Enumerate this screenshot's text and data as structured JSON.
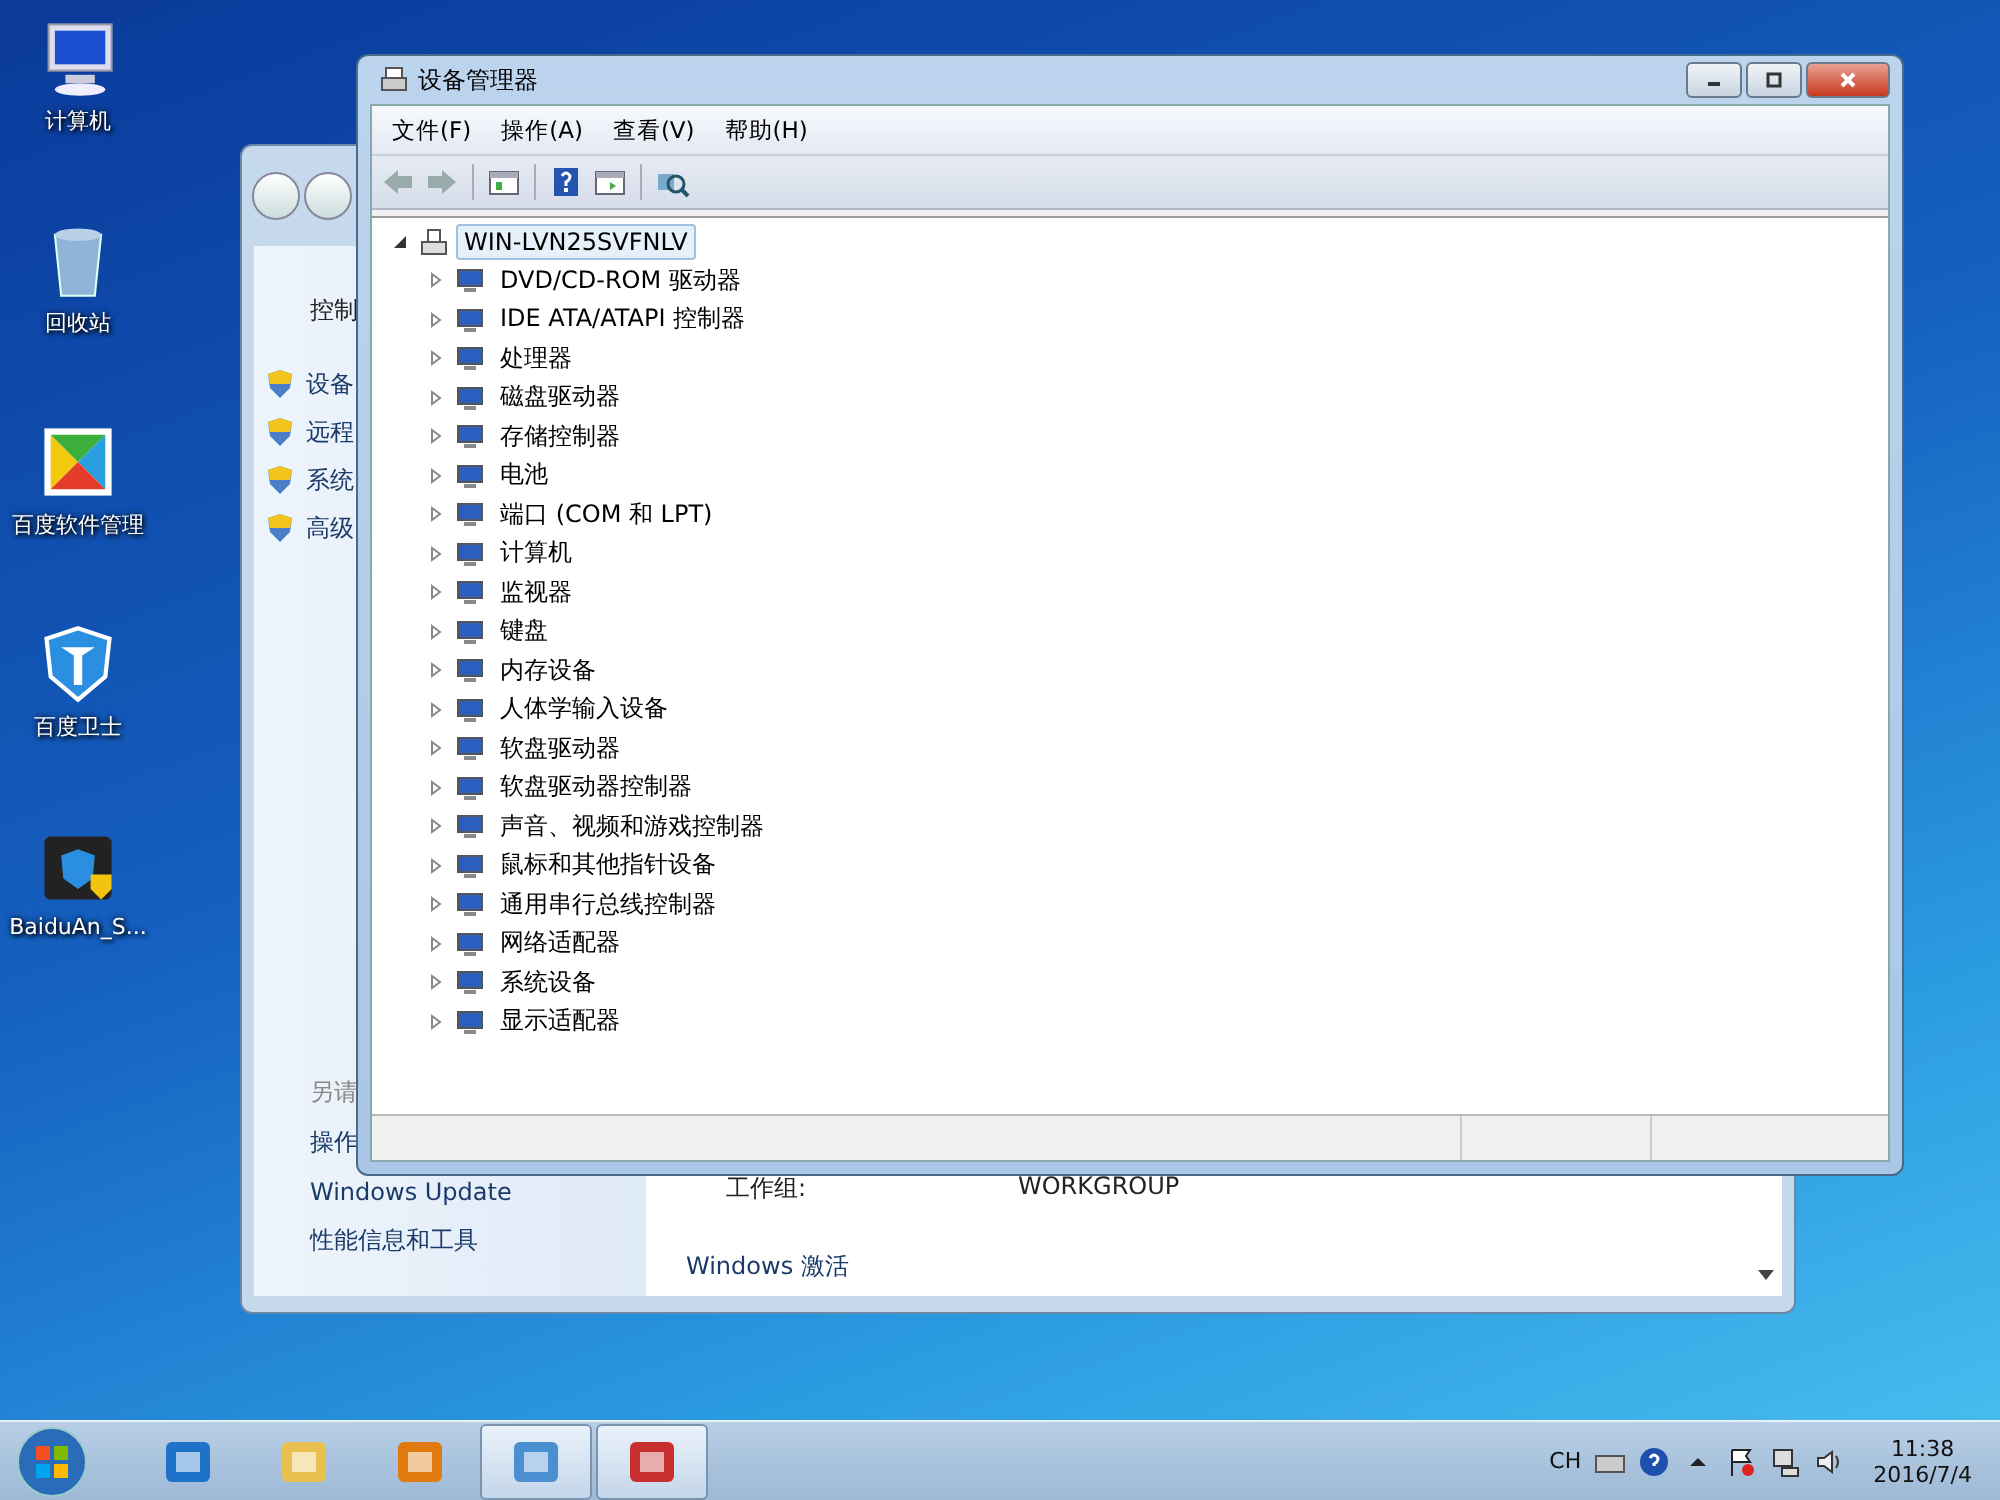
{
  "desktop_icons": [
    {
      "label": "计算机"
    },
    {
      "label": "回收站"
    },
    {
      "label": "百度软件管理"
    },
    {
      "label": "百度卫士"
    },
    {
      "label": "BaiduAn_S..."
    }
  ],
  "background_window": {
    "left_pane": {
      "title": "控制",
      "links": [
        "设备",
        "远程",
        "系统",
        "高级"
      ],
      "see_also": "另请",
      "see_also_links": [
        "操作",
        "Windows Update",
        "性能信息和工具"
      ]
    },
    "details": [
      {
        "label": "工作组:",
        "value": "WORKGROUP"
      }
    ],
    "section": "Windows 激活"
  },
  "window": {
    "title": "设备管理器",
    "menu": [
      "文件(F)",
      "操作(A)",
      "查看(V)",
      "帮助(H)"
    ],
    "tree": {
      "label": "WIN-LVN25SVFNLV",
      "expanded": true,
      "selected": true,
      "children": [
        {
          "label": "DVD/CD-ROM 驱动器",
          "expanded": false
        },
        {
          "label": "IDE ATA/ATAPI 控制器",
          "expanded": false
        },
        {
          "label": "处理器",
          "expanded": false
        },
        {
          "label": "磁盘驱动器",
          "expanded": false
        },
        {
          "label": "存储控制器",
          "expanded": false
        },
        {
          "label": "电池",
          "expanded": false
        },
        {
          "label": "端口 (COM 和 LPT)",
          "expanded": false
        },
        {
          "label": "计算机",
          "expanded": false
        },
        {
          "label": "监视器",
          "expanded": false
        },
        {
          "label": "键盘",
          "expanded": false
        },
        {
          "label": "内存设备",
          "expanded": false
        },
        {
          "label": "人体学输入设备",
          "expanded": false
        },
        {
          "label": "软盘驱动器",
          "expanded": false
        },
        {
          "label": "软盘驱动器控制器",
          "expanded": false
        },
        {
          "label": "声音、视频和游戏控制器",
          "expanded": false
        },
        {
          "label": "鼠标和其他指针设备",
          "expanded": false
        },
        {
          "label": "通用串行总线控制器",
          "expanded": false
        },
        {
          "label": "网络适配器",
          "expanded": false
        },
        {
          "label": "系统设备",
          "expanded": false
        },
        {
          "label": "显示适配器",
          "expanded": false
        }
      ]
    }
  },
  "taskbar": {
    "apps": [
      {
        "selected": false
      },
      {
        "selected": false
      },
      {
        "selected": false
      },
      {
        "selected": true
      },
      {
        "selected": true
      }
    ],
    "language": "CH",
    "time": "11:38",
    "date": "2016/7/4"
  }
}
